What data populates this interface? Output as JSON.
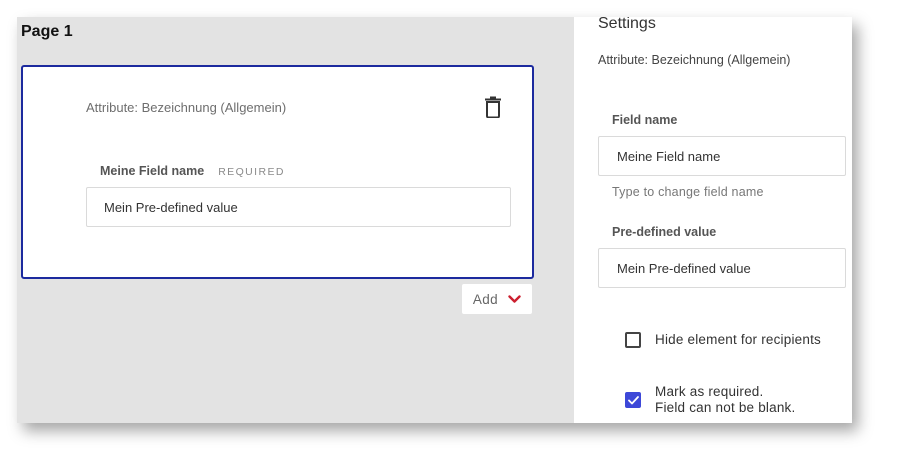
{
  "page": {
    "title": "Page 1"
  },
  "card": {
    "attribute_label": "Attribute: Bezeichnung (Allgemein)",
    "field_label": "Meine Field name",
    "required_tag": "REQUIRED",
    "input_value": "Mein Pre-defined value",
    "delete_icon": "trash-icon"
  },
  "add_button": {
    "label": "Add",
    "icon": "chevron-down-icon",
    "icon_color": "#cc1f2f"
  },
  "settings": {
    "title": "Settings",
    "attribute_label": "Attribute: Bezeichnung (Allgemein)",
    "field_name_label": "Field name",
    "field_name_value": "Meine Field name",
    "field_name_hint": "Type to change field name",
    "predefined_label": "Pre-defined value",
    "predefined_value": "Mein Pre-defined value",
    "hide_element": {
      "label": "Hide element for recipients",
      "checked": false
    },
    "mark_required": {
      "label_line1": "Mark as required.",
      "label_line2": "Field can not be blank.",
      "checked": true
    }
  },
  "colors": {
    "selection_border": "#1c2a9e",
    "checkbox_checked": "#3d48d8",
    "canvas_background": "#e3e3e3"
  }
}
